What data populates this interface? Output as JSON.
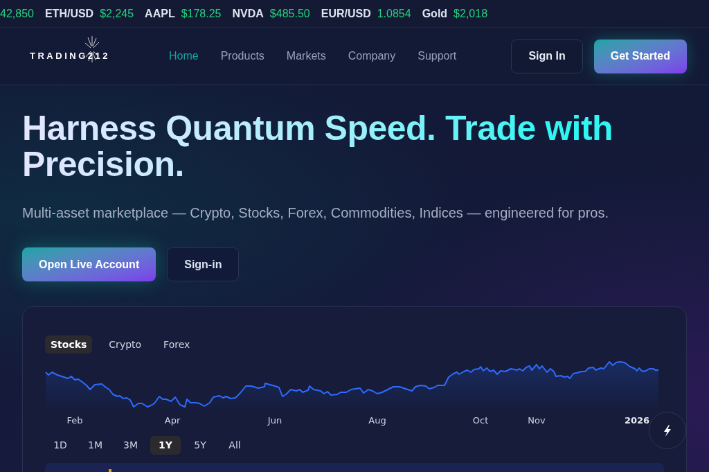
{
  "ticker": [
    {
      "price": "42,850"
    },
    {
      "symbol": "ETH/USD",
      "price": "$2,245"
    },
    {
      "symbol": "AAPL",
      "price": "$178.25"
    },
    {
      "symbol": "NVDA",
      "price": "$485.50"
    },
    {
      "symbol": "EUR/USD",
      "price": "1.0854"
    },
    {
      "symbol": "Gold",
      "price": "$2,018"
    }
  ],
  "nav": {
    "logo": "TRADING212",
    "links": [
      {
        "label": "Home",
        "selected": true
      },
      {
        "label": "Products",
        "selected": false
      },
      {
        "label": "Markets",
        "selected": false
      },
      {
        "label": "Company",
        "selected": false
      },
      {
        "label": "Support",
        "selected": false
      }
    ],
    "buttons": [
      {
        "label": "Sign In",
        "kind": "outline"
      },
      {
        "label": "Get Started",
        "kind": "primary"
      }
    ]
  },
  "hero": {
    "title": "Harness Quantum Speed. Trade with Precision.",
    "subtitle": "Multi-asset marketplace — Crypto, Stocks, Forex, Commodities, Indices — engineered for pros.",
    "buttons": [
      {
        "label": "Open Live Account",
        "kind": "primary"
      },
      {
        "label": "Sign-in",
        "kind": "outline"
      }
    ]
  },
  "chart_card": {
    "tabs": [
      {
        "label": "Stocks",
        "selected": true
      },
      {
        "label": "Crypto",
        "selected": false
      },
      {
        "label": "Forex",
        "selected": false
      }
    ],
    "x_labels": [
      {
        "label": "Feb",
        "kind": "month"
      },
      {
        "label": "Apr",
        "kind": "month"
      },
      {
        "label": "Jun",
        "kind": "month"
      },
      {
        "label": "Aug",
        "kind": "month"
      },
      {
        "label": "Oct",
        "kind": "month"
      },
      {
        "label": "Nov",
        "kind": "month"
      },
      {
        "label": "2026",
        "kind": "year"
      }
    ],
    "ranges": [
      {
        "label": "1D",
        "selected": false
      },
      {
        "label": "1M",
        "selected": false
      },
      {
        "label": "3M",
        "selected": false
      },
      {
        "label": "1Y",
        "selected": true
      },
      {
        "label": "5Y",
        "selected": false
      },
      {
        "label": "All",
        "selected": false
      }
    ]
  }
}
